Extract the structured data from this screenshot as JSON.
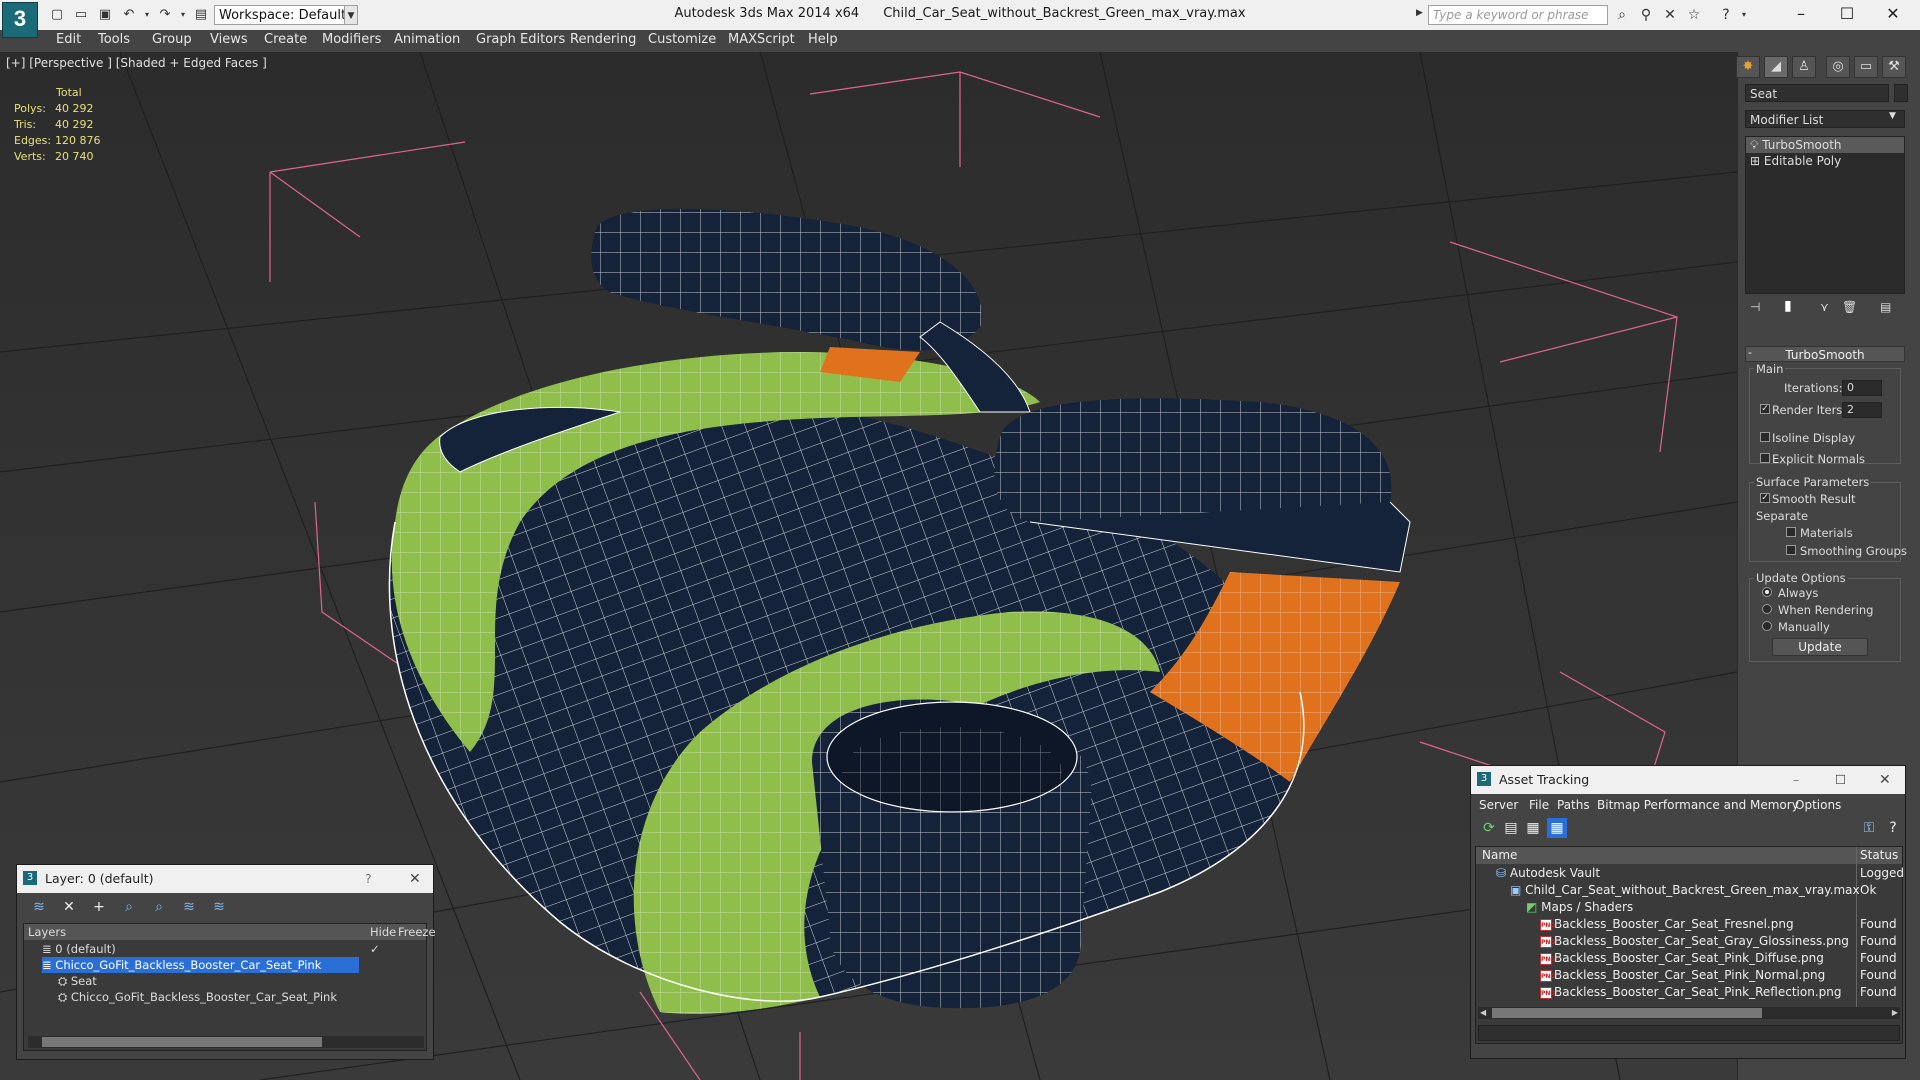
{
  "titlebar": {
    "app": "Autodesk 3ds Max  2014 x64",
    "file": "Child_Car_Seat_without_Backrest_Green_max_vray.max",
    "workspace": "Workspace: Default",
    "search_placeholder": "Type a keyword or phrase",
    "logo": "3"
  },
  "menus": [
    "Edit",
    "Tools",
    "Group",
    "Views",
    "Create",
    "Modifiers",
    "Animation",
    "Graph Editors",
    "Rendering",
    "Customize",
    "MAXScript",
    "Help"
  ],
  "viewport": {
    "label": "[+] [Perspective ] [Shaded + Edged Faces ]",
    "stats": {
      "header": "Total",
      "rows": [
        {
          "label": "Polys:",
          "value": "40 292"
        },
        {
          "label": "Tris:",
          "value": "40 292"
        },
        {
          "label": "Edges:",
          "value": "120 876"
        },
        {
          "label": "Verts:",
          "value": "20 740"
        }
      ]
    }
  },
  "command_panel": {
    "object_name": "Seat",
    "modifier_list": "Modifier List",
    "stack": [
      "TurboSmooth",
      "Editable Poly"
    ],
    "rollout_title": "TurboSmooth",
    "main_label": "Main",
    "iterations_label": "Iterations:",
    "iterations_value": "0",
    "render_iters_label": "Render Iters:",
    "render_iters_value": "2",
    "isoline": "Isoline Display",
    "explicit_normals": "Explicit Normals",
    "surface_params": "Surface Parameters",
    "smooth_result": "Smooth Result",
    "separate": "Separate",
    "materials": "Materials",
    "smoothing_groups": "Smoothing Groups",
    "update_options": "Update Options",
    "always": "Always",
    "when_rendering": "When Rendering",
    "manually": "Manually",
    "update_button": "Update"
  },
  "layer_dialog": {
    "title": "Layer: 0 (default)",
    "help": "?",
    "columns": {
      "layers": "Layers",
      "hide": "Hide",
      "freeze": "Freeze"
    },
    "rows": [
      {
        "name": "0 (default)",
        "level": 0
      },
      {
        "name": "Chicco_GoFit_Backless_Booster_Car_Seat_Pink",
        "level": 0,
        "selected": true
      },
      {
        "name": "Seat",
        "level": 1
      },
      {
        "name": "Chicco_GoFit_Backless_Booster_Car_Seat_Pink",
        "level": 1
      }
    ]
  },
  "asset_dialog": {
    "title": "Asset Tracking",
    "menus": [
      "Server",
      "File",
      "Paths",
      "Bitmap Performance and Memory",
      "Options"
    ],
    "columns": {
      "name": "Name",
      "status": "Status"
    },
    "rows": [
      {
        "name": "Autodesk Vault",
        "status": "Logged",
        "indent": 0,
        "kind": "vault"
      },
      {
        "name": "Child_Car_Seat_without_Backrest_Green_max_vray.max",
        "status": "Ok",
        "indent": 1,
        "kind": "file"
      },
      {
        "name": "Maps / Shaders",
        "status": "",
        "indent": 2,
        "kind": "folder"
      },
      {
        "name": "Backless_Booster_Car_Seat_Fresnel.png",
        "status": "Found",
        "indent": 3,
        "kind": "png"
      },
      {
        "name": "Backless_Booster_Car_Seat_Gray_Glossiness.png",
        "status": "Found",
        "indent": 3,
        "kind": "png"
      },
      {
        "name": "Backless_Booster_Car_Seat_Pink_Diffuse.png",
        "status": "Found",
        "indent": 3,
        "kind": "png"
      },
      {
        "name": "Backless_Booster_Car_Seat_Pink_Normal.png",
        "status": "Found",
        "indent": 3,
        "kind": "png"
      },
      {
        "name": "Backless_Booster_Car_Seat_Pink_Reflection.png",
        "status": "Found",
        "indent": 3,
        "kind": "png"
      }
    ]
  },
  "colors": {
    "seat_navy": "#14233a",
    "seat_green": "#8fbf4a",
    "seat_orange": "#e0721e",
    "bounding_box": "#e0658e",
    "stats": "#e8e07a"
  }
}
